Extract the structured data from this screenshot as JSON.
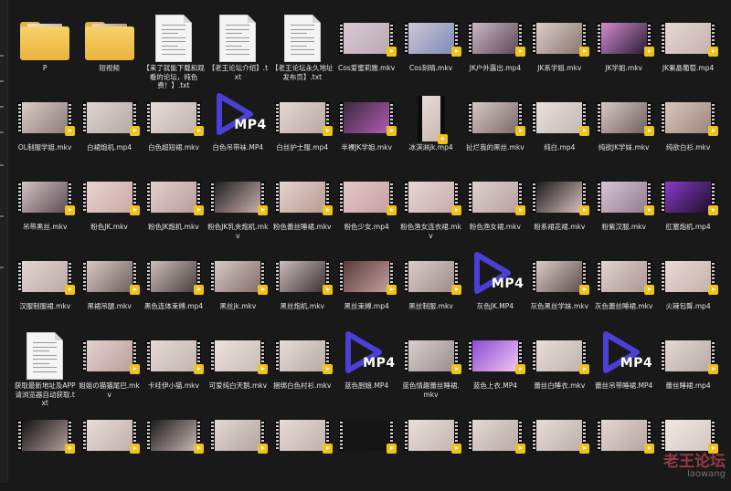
{
  "colors": {
    "background": "#191919",
    "text": "#e6e6e6",
    "badge": "#f0c21a",
    "play_icon": "#4b3fd6"
  },
  "items": [
    {
      "type": "folder",
      "label": "P",
      "thumb": [
        "#efe1dc",
        "#c9b6b1"
      ]
    },
    {
      "type": "folder",
      "label": "短视频",
      "thumb": [
        "#e9d7d2",
        "#b89d96"
      ]
    },
    {
      "type": "doc",
      "label": "【来了就能下载和观看的论坛，纯色费！】.txt"
    },
    {
      "type": "doc",
      "label": "【老王论坛介绍】.txt"
    },
    {
      "type": "doc",
      "label": "【老王论坛永久地址发布页】.txt"
    },
    {
      "type": "video",
      "label": "Cos爱蜜莉雅.mkv",
      "thumb": [
        "#d8cbd2",
        "#b9a8b3"
      ]
    },
    {
      "type": "video",
      "label": "Cos刻晴.mkv",
      "thumb": [
        "#cfc7d8",
        "#7d8bb5"
      ]
    },
    {
      "type": "video",
      "label": "JK户外露出.mp4",
      "thumb": [
        "#cbb7c3",
        "#5d4a56"
      ]
    },
    {
      "type": "video",
      "label": "JK系学姐.mkv",
      "thumb": [
        "#d9cfcc",
        "#8a766f"
      ]
    },
    {
      "type": "video",
      "label": "JK学姐.mkv",
      "thumb": [
        "#d58bcf",
        "#2b1b33"
      ]
    },
    {
      "type": "video",
      "label": "JK紫晶葡萄.mp4",
      "thumb": [
        "#e6d8d6",
        "#c4b1ae"
      ]
    },
    {
      "type": "video",
      "label": "OL制服学姐.mkv",
      "thumb": [
        "#d9cbc8",
        "#8a7c7a"
      ]
    },
    {
      "type": "video",
      "label": "白裙炮机.mp4",
      "thumb": [
        "#ddd6d3",
        "#b3a9a5"
      ]
    },
    {
      "type": "video",
      "label": "白色超短裙.mkv",
      "thumb": [
        "#e5dcd9",
        "#c0b2ad"
      ]
    },
    {
      "type": "mp4",
      "label": "白色吊带袜.MP4",
      "icon_text": "MP4"
    },
    {
      "type": "video",
      "label": "白丝护士服.mp4",
      "thumb": [
        "#e6d9d5",
        "#b8a7a3"
      ]
    },
    {
      "type": "video",
      "label": "半裸JK学姐.mkv",
      "thumb": [
        "#3a2a3e",
        "#b05bb3"
      ]
    },
    {
      "type": "video_portrait",
      "label": "冰淇淋jk.mp4",
      "thumb": [
        "#e8ddd9",
        "#c7b7b2"
      ]
    },
    {
      "type": "video",
      "label": "扯烂我的黑丝.mkv",
      "thumb": [
        "#d5c6c6",
        "#7c6a6a"
      ]
    },
    {
      "type": "video",
      "label": "纯白.mp4",
      "thumb": [
        "#e9e2df",
        "#c2b8b4"
      ]
    },
    {
      "type": "video",
      "label": "纯欲JK学妹.mkv",
      "thumb": [
        "#d4c8c6",
        "#6f6160"
      ]
    },
    {
      "type": "video",
      "label": "纯欲白衫.mkv",
      "thumb": [
        "#d8c7bf",
        "#9b867d"
      ]
    },
    {
      "type": "video",
      "label": "吊带黑丝.mkv",
      "thumb": [
        "#d1c3c3",
        "#5b4d52"
      ]
    },
    {
      "type": "video",
      "label": "粉色JK.mkv",
      "thumb": [
        "#e9d3d1",
        "#c9a9a5"
      ]
    },
    {
      "type": "video",
      "label": "粉色JK炮机.mkv",
      "thumb": [
        "#e3cfcf",
        "#b99c9c"
      ]
    },
    {
      "type": "video",
      "label": "粉色JK乳夹炮机.mkv",
      "thumb": [
        "#202020",
        "#cbaeae"
      ]
    },
    {
      "type": "video",
      "label": "粉色蕾丝睡裙.mkv",
      "thumb": [
        "#e6d3cf",
        "#b79a94"
      ]
    },
    {
      "type": "video",
      "label": "粉色少女.mp4",
      "thumb": [
        "#e4c9cb",
        "#c79ea4"
      ]
    },
    {
      "type": "video",
      "label": "粉色渔女连衣裙.mkv",
      "thumb": [
        "#e7d6d6",
        "#c6acac"
      ]
    },
    {
      "type": "video",
      "label": "粉色渔女裙.mkv",
      "thumb": [
        "#dfcfcf",
        "#b6a2a2"
      ]
    },
    {
      "type": "video",
      "label": "粉系裙花裙.mkv",
      "thumb": [
        "#1a1a1a",
        "#d8c2c0"
      ]
    },
    {
      "type": "video",
      "label": "粉紫汉服.mkv",
      "thumb": [
        "#d8c6d4",
        "#8f7b8e"
      ]
    },
    {
      "type": "video",
      "label": "肛塞炮机.mp4",
      "thumb": [
        "#8a3ac6",
        "#1c0f2a"
      ]
    },
    {
      "type": "video",
      "label": "汉服制服裙.mkv",
      "thumb": [
        "#e2d5d3",
        "#b9a9a6"
      ]
    },
    {
      "type": "video",
      "label": "黑裙吊腿.mkv",
      "thumb": [
        "#d7cac7",
        "#6d5f5d"
      ]
    },
    {
      "type": "video",
      "label": "黑色连体束缚.mp4",
      "thumb": [
        "#cbbdbc",
        "#4a3f3f"
      ]
    },
    {
      "type": "video",
      "label": "黑丝jk.mkv",
      "thumb": [
        "#d6c9c7",
        "#826f6b"
      ]
    },
    {
      "type": "video",
      "label": "黑丝炮机.mkv",
      "thumb": [
        "#c9bcbc",
        "#3c3335"
      ]
    },
    {
      "type": "video",
      "label": "黑丝束缚.mp4",
      "thumb": [
        "#5a3a3a",
        "#c39fa0"
      ]
    },
    {
      "type": "video",
      "label": "黑丝制服.mkv",
      "thumb": [
        "#d9cdcb",
        "#9d8d8a"
      ]
    },
    {
      "type": "mp4",
      "label": "灰色JK.MP4",
      "icon_text": "MP4"
    },
    {
      "type": "video",
      "label": "灰色黑丝学妹.mkv",
      "thumb": [
        "#d8ccc9",
        "#5e4f4e"
      ]
    },
    {
      "type": "video",
      "label": "灰色蕾丝睡裙.mkv",
      "thumb": [
        "#e0d3d0",
        "#aa9894"
      ]
    },
    {
      "type": "video",
      "label": "火辣包臀.mp4",
      "thumb": [
        "#e7dad6",
        "#c5b1ab"
      ]
    },
    {
      "type": "doc",
      "label": "获取最新地址及APP请浏览器自动获取.txt"
    },
    {
      "type": "video",
      "label": "姐姐の猫猫尾巴.mkv",
      "thumb": [
        "#e2d2cf",
        "#b89f9b"
      ]
    },
    {
      "type": "video",
      "label": "卡哇伊小猫.mkv",
      "thumb": [
        "#e4dad8",
        "#c3b4b1"
      ]
    },
    {
      "type": "video",
      "label": "可爱纯白天鹅.mkv",
      "thumb": [
        "#ebe2df",
        "#cabcb7"
      ]
    },
    {
      "type": "video",
      "label": "捆绑白色衬衫.mkv",
      "thumb": [
        "#e5dcd9",
        "#b7aaa6"
      ]
    },
    {
      "type": "mp4",
      "label": "蓝色厨娘.MP4",
      "icon_text": "MP4"
    },
    {
      "type": "video",
      "label": "蓝色情趣蕾丝睡裙.mkv",
      "thumb": [
        "#d9d0d0",
        "#9b8d8d"
      ]
    },
    {
      "type": "video",
      "label": "蓝色上衣.MP4",
      "thumb": [
        "#8c49d6",
        "#f0c8f0"
      ]
    },
    {
      "type": "video",
      "label": "蕾丝白睡衣.mkv",
      "thumb": [
        "#e6ddda",
        "#c1b3af"
      ]
    },
    {
      "type": "mp4",
      "label": "蕾丝吊带睡裙.MP4",
      "icon_text": "MP4"
    },
    {
      "type": "video",
      "label": "蕾丝睡裙.mp4",
      "thumb": [
        "#e2d8d5",
        "#b9aba7"
      ]
    },
    {
      "type": "video",
      "label": "",
      "thumb": [
        "#111111",
        "#b59e9b"
      ]
    },
    {
      "type": "video",
      "label": "",
      "thumb": [
        "#e7dcd9",
        "#c2b0ab"
      ]
    },
    {
      "type": "video",
      "label": "",
      "thumb": [
        "#1b1b1b",
        "#c7b6b2"
      ]
    },
    {
      "type": "video",
      "label": "",
      "thumb": [
        "#e2d8d5",
        "#b3a5a1"
      ]
    },
    {
      "type": "video",
      "label": "",
      "thumb": [
        "#e6dbd8",
        "#c0b0ab"
      ]
    },
    {
      "type": "video",
      "label": "",
      "thumb": [
        "#161616",
        "#151515"
      ]
    },
    {
      "type": "video",
      "label": "",
      "thumb": [
        "#e9dfdc",
        "#c4b6b2"
      ]
    },
    {
      "type": "video",
      "label": "",
      "thumb": [
        "#e3d8d5",
        "#b9aaa6"
      ]
    },
    {
      "type": "video",
      "label": "",
      "thumb": [
        "#e5dbd8",
        "#bdb0ac"
      ]
    },
    {
      "type": "video",
      "label": "",
      "thumb": [
        "#e3d6d3",
        "#b6a5a1"
      ]
    },
    {
      "type": "video",
      "label": "",
      "thumb": [
        "#f0e8e6",
        "#d3c6c2"
      ]
    }
  ],
  "watermark": {
    "cn": "老王论坛",
    "en": "laowang"
  }
}
